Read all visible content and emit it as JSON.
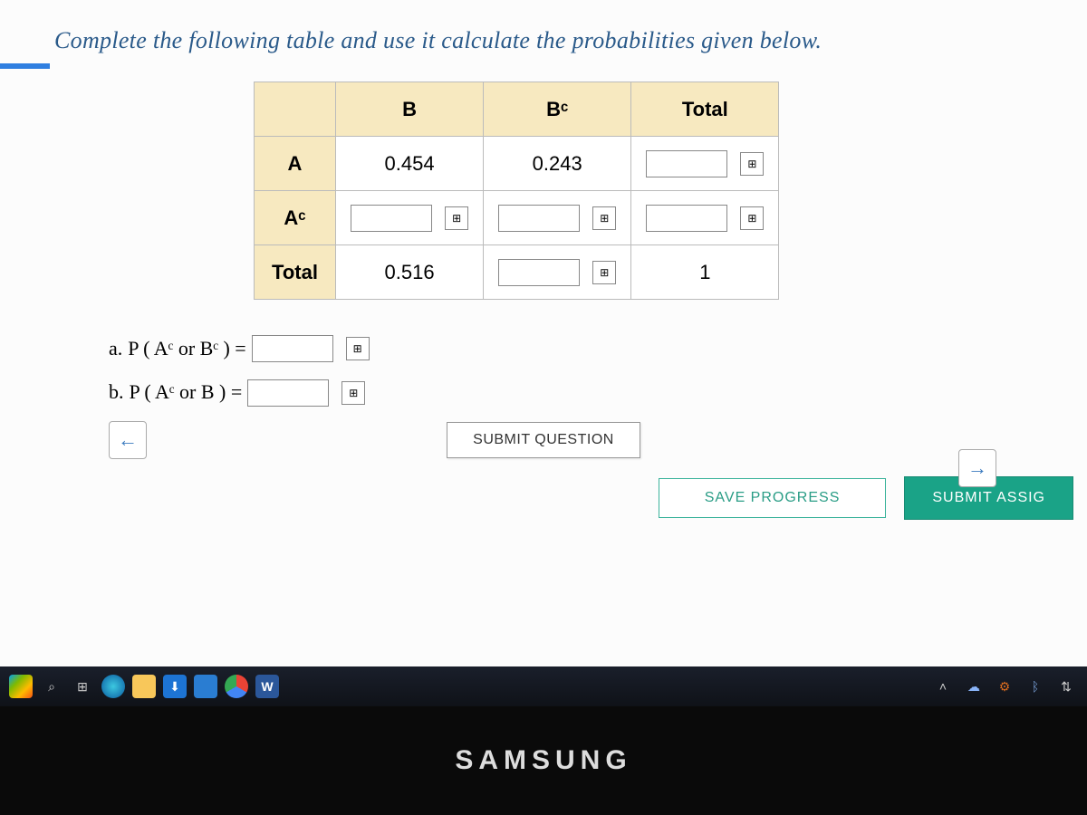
{
  "instruction": "Complete the following table and use it calculate the probabilities given below.",
  "table": {
    "col_headers": {
      "b": "B",
      "bc": "Bᶜ",
      "total": "Total"
    },
    "row_headers": {
      "a": "A",
      "ac": "Aᶜ",
      "total": "Total"
    },
    "cells": {
      "a_b": "0.454",
      "a_bc": "0.243",
      "total_b": "0.516",
      "total_total": "1"
    }
  },
  "questions": {
    "a_label": "a. ",
    "a_expr": "P ( Aᶜ or Bᶜ ) =",
    "b_label": "b. ",
    "b_expr": "P ( Aᶜ or B ) ="
  },
  "buttons": {
    "submit_question": "SUBMIT QUESTION",
    "save_progress": "SAVE PROGRESS",
    "submit_assignment": "SUBMIT ASSIG"
  },
  "bezel_brand": "SAMSUNG"
}
